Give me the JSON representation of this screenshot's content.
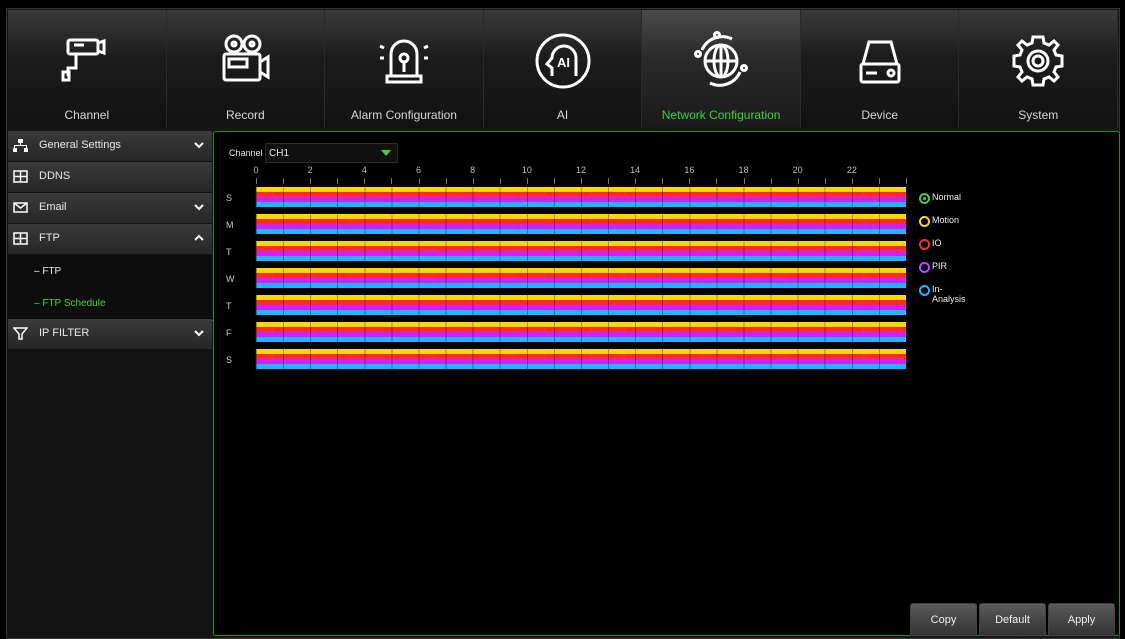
{
  "nav": {
    "tabs": [
      {
        "label": "Channel",
        "icon": "camera-icon"
      },
      {
        "label": "Record",
        "icon": "video-camera-icon"
      },
      {
        "label": "Alarm Configuration",
        "icon": "alarm-light-icon"
      },
      {
        "label": "AI",
        "icon": "ai-head-icon"
      },
      {
        "label": "Network Configuration",
        "icon": "globe-network-icon",
        "active": true
      },
      {
        "label": "Device",
        "icon": "hard-drive-icon"
      },
      {
        "label": "System",
        "icon": "gear-icon"
      }
    ]
  },
  "sidebar": {
    "items": [
      {
        "label": "General Settings",
        "icon": "network-icon",
        "chevron": "down"
      },
      {
        "label": "DDNS",
        "icon": "ddns-icon"
      },
      {
        "label": "Email",
        "icon": "envelope-icon",
        "chevron": "down"
      },
      {
        "label": "FTP",
        "icon": "ftp-icon",
        "chevron": "up"
      },
      {
        "label": "IP FILTER",
        "icon": "filter-icon",
        "chevron": "down"
      }
    ],
    "subitems": [
      {
        "label": "– FTP"
      },
      {
        "label": "– FTP Schedule",
        "active": true
      }
    ]
  },
  "schedule": {
    "channel_label": "Channel",
    "channel_value": "CH1",
    "hours": [
      "0",
      "2",
      "4",
      "6",
      "8",
      "10",
      "12",
      "14",
      "16",
      "18",
      "20",
      "22"
    ],
    "days": [
      "S",
      "M",
      "T",
      "W",
      "T",
      "F",
      "S"
    ],
    "legend": [
      {
        "label": "Normal",
        "color": "#3fd13f",
        "selected": true
      },
      {
        "label": "Motion",
        "color": "#ffd800"
      },
      {
        "label": "IO",
        "color": "#ff2a2a"
      },
      {
        "label": "PIR",
        "color": "#b04cff"
      },
      {
        "label": "In-Analysis",
        "color": "#20b6ff"
      }
    ]
  },
  "buttons": {
    "copy": "Copy",
    "default": "Default",
    "apply": "Apply"
  },
  "colors": {
    "accent": "#3fd13f",
    "motion": "#ffd800",
    "io": "#ff2a2a",
    "pir": "#d020ff",
    "analysis": "#20b6ff"
  }
}
